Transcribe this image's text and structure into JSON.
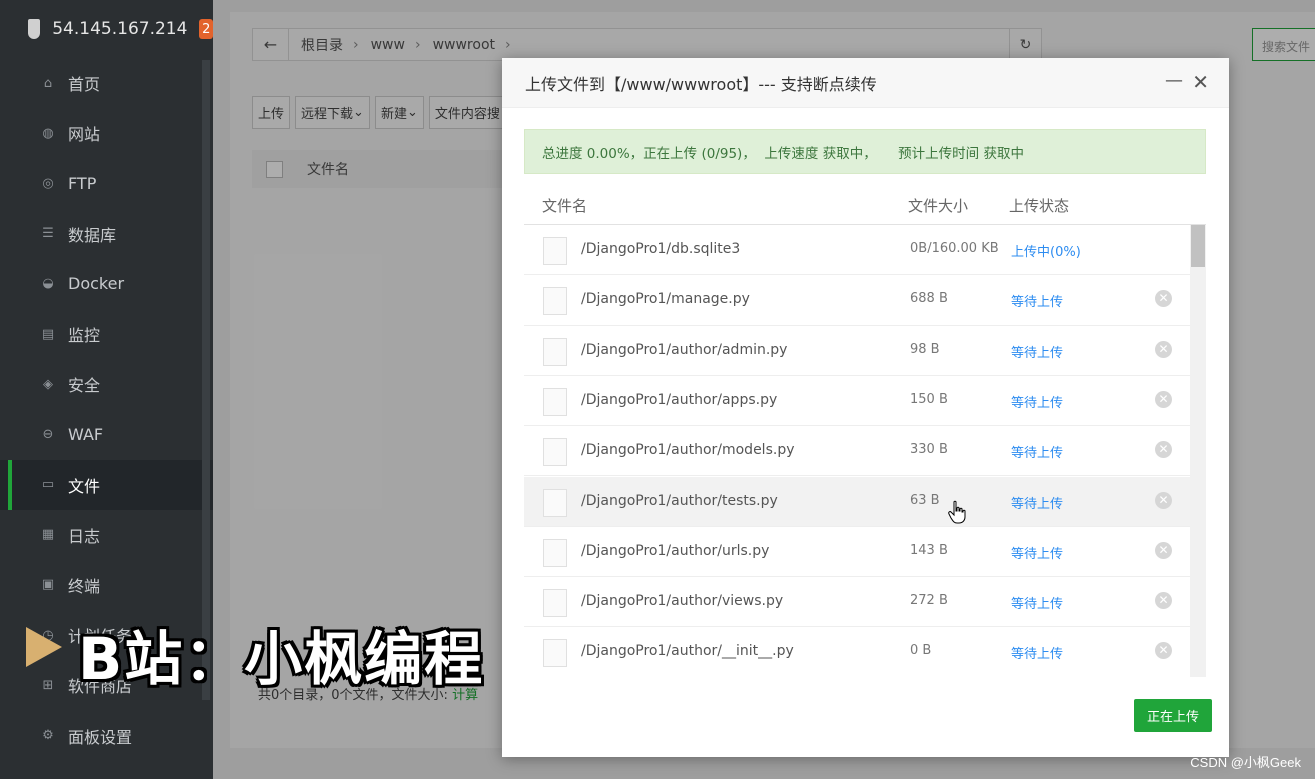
{
  "sidebar": {
    "ip": "54.145.167.214",
    "badge": "2",
    "items": [
      {
        "label": "首页",
        "icon": "home-icon",
        "glyph": "⌂"
      },
      {
        "label": "网站",
        "icon": "globe-icon",
        "glyph": "◍"
      },
      {
        "label": "FTP",
        "icon": "ftp-icon",
        "glyph": "◎"
      },
      {
        "label": "数据库",
        "icon": "database-icon",
        "glyph": "☰"
      },
      {
        "label": "Docker",
        "icon": "docker-icon",
        "glyph": "◒"
      },
      {
        "label": "监控",
        "icon": "monitor-icon",
        "glyph": "▤"
      },
      {
        "label": "安全",
        "icon": "shield-icon",
        "glyph": "◈"
      },
      {
        "label": "WAF",
        "icon": "waf-icon",
        "glyph": "⊖"
      },
      {
        "label": "文件",
        "icon": "folder-icon",
        "glyph": "▭"
      },
      {
        "label": "日志",
        "icon": "log-icon",
        "glyph": "▦"
      },
      {
        "label": "终端",
        "icon": "terminal-icon",
        "glyph": "▣"
      },
      {
        "label": "计划任务",
        "icon": "cron-icon",
        "glyph": "◷"
      },
      {
        "label": "软件商店",
        "icon": "store-icon",
        "glyph": "⊞"
      },
      {
        "label": "面板设置",
        "icon": "gear-icon",
        "glyph": "⚙"
      }
    ],
    "active_index": 8
  },
  "pathbar": {
    "crumbs": [
      "根目录",
      "www",
      "wwwroot"
    ],
    "search_placeholder": "搜索文件"
  },
  "toolbar": {
    "upload": "上传",
    "remote_download": "远程下载",
    "new": "新建",
    "content_search": "文件内容搜"
  },
  "file_table": {
    "name_header": "文件名"
  },
  "summary": {
    "text": "共0个目录，0个文件，文件大小: ",
    "calc": "计算"
  },
  "modal": {
    "title": "上传文件到【/www/wwwroot】--- 支持断点续传",
    "progress": "总进度 0.00%，正在上传 (0/95)，  上传速度 获取中，     预计上传时间 获取中",
    "headers": {
      "name": "文件名",
      "size": "文件大小",
      "status": "上传状态"
    },
    "files": [
      {
        "name": "/DjangoPro1/db.sqlite3",
        "size": "0B/160.00 KB",
        "status": "上传中(0%)"
      },
      {
        "name": "/DjangoPro1/manage.py",
        "size": "688 B",
        "status": "等待上传"
      },
      {
        "name": "/DjangoPro1/author/admin.py",
        "size": "98 B",
        "status": "等待上传"
      },
      {
        "name": "/DjangoPro1/author/apps.py",
        "size": "150 B",
        "status": "等待上传"
      },
      {
        "name": "/DjangoPro1/author/models.py",
        "size": "330 B",
        "status": "等待上传"
      },
      {
        "name": "/DjangoPro1/author/tests.py",
        "size": "63 B",
        "status": "等待上传"
      },
      {
        "name": "/DjangoPro1/author/urls.py",
        "size": "143 B",
        "status": "等待上传"
      },
      {
        "name": "/DjangoPro1/author/views.py",
        "size": "272 B",
        "status": "等待上传"
      },
      {
        "name": "/DjangoPro1/author/__init__.py",
        "size": "0 B",
        "status": "等待上传"
      }
    ],
    "hover_index": 5,
    "button": "正在上传"
  },
  "watermark": {
    "big": "B站：小枫编程",
    "small": "CSDN @小枫Geek"
  }
}
